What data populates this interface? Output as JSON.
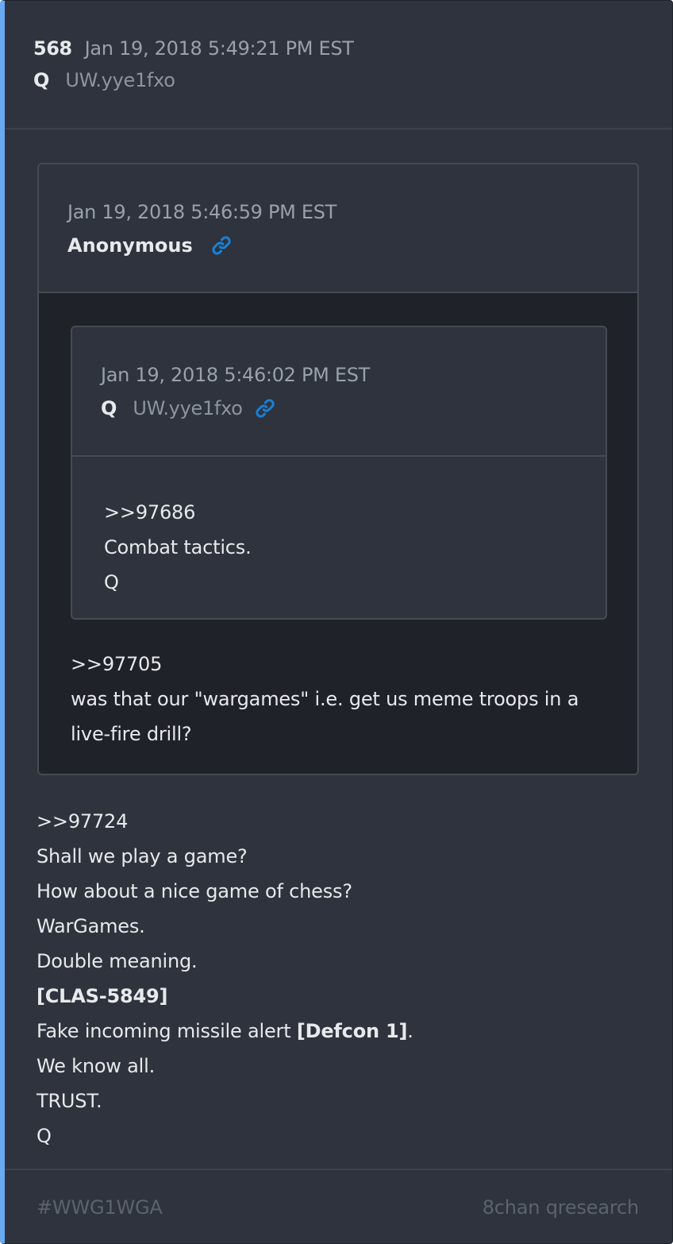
{
  "post": {
    "number": "568",
    "date": "Jan 19, 2018 5:49:21 PM EST",
    "author": "Q",
    "tripcode": "UW.yye1fxo"
  },
  "quote1": {
    "date": "Jan 19, 2018 5:46:59 PM EST",
    "author": "Anonymous",
    "link_icon": "link-icon",
    "lines": [
      ">>97705",
      "was that our \"wargames\" i.e. get us meme troops in a live-fire drill?"
    ]
  },
  "quote2": {
    "date": "Jan 19, 2018 5:46:02 PM EST",
    "author": "Q",
    "tripcode": "UW.yye1fxo",
    "link_icon": "link-icon",
    "lines": [
      ">>97686",
      "Combat tactics.",
      "Q"
    ]
  },
  "body": {
    "line1": ">>97724",
    "line2": "Shall we play a game?",
    "line3": "How about a nice game of chess?",
    "line4": "WarGames.",
    "line5": "Double meaning.",
    "line6": "[CLAS-5849]",
    "line7_pre": "Fake incoming missile alert ",
    "line7_bold": "[Defcon 1]",
    "line7_post": ".",
    "line8": "We know all.",
    "line9": "TRUST.",
    "line10": "Q"
  },
  "footer": {
    "tag": "#WWG1WGA",
    "source": "8chan qresearch"
  },
  "colors": {
    "accent_border": "#6aaaf0",
    "link_icon": "#1b7fd4",
    "background": "#2e333d",
    "quote_background": "#1f2329"
  }
}
